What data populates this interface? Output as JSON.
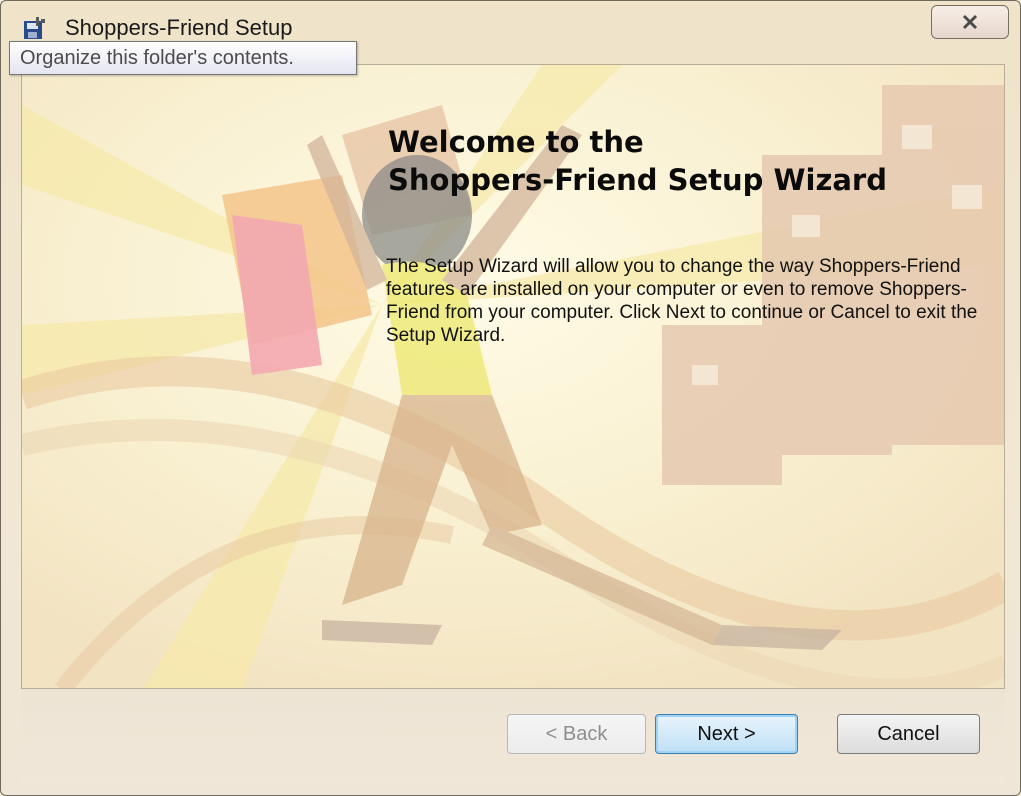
{
  "window": {
    "title": "Shoppers-Friend Setup",
    "icon": "installer-disk-icon"
  },
  "tooltip": {
    "text": "Organize this folder's contents."
  },
  "wizard": {
    "heading_line1": "Welcome to the",
    "heading_line2": "Shoppers-Friend Setup Wizard",
    "body": "The Setup Wizard will allow you to change the way Shoppers-Friend features are installed on your computer or even to remove Shoppers-Friend from your computer.  Click Next to continue or Cancel to exit the Setup Wizard."
  },
  "buttons": {
    "back": "< Back",
    "next": "Next >",
    "cancel": "Cancel"
  },
  "colors": {
    "accent": "#3c7fb1",
    "background": "#f4eedd"
  }
}
